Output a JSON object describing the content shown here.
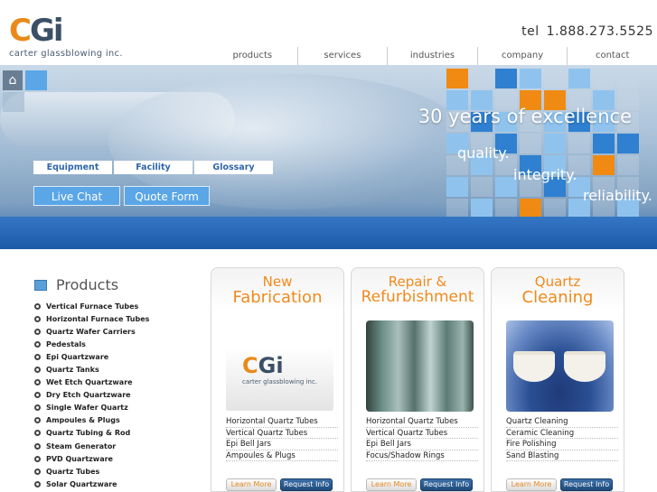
{
  "header": {
    "logo_mark_c": "C",
    "logo_mark_gi": "Gi",
    "logo_text": "carter glassblowing inc.",
    "tel_label": "tel",
    "tel_number": "1.888.273.5525"
  },
  "topnav": [
    "products",
    "services",
    "industries",
    "company",
    "contact"
  ],
  "hero": {
    "headline": "30 years of excellence",
    "quality": "quality.",
    "integrity": "integrity.",
    "reliability": "reliability.",
    "subnav": [
      "Equipment",
      "Facility",
      "Glossary"
    ],
    "live_chat": "Live Chat",
    "quote_form": "Quote Form",
    "colors": {
      "orange": "#f08a12",
      "blue": "#2f80d0",
      "light_blue": "#8fc3ee",
      "band": "#2d6cba"
    }
  },
  "products": {
    "title": "Products",
    "items": [
      "Vertical Furnace Tubes",
      "Horizontal Furnace Tubes",
      "Quartz Wafer Carriers",
      "Pedestals",
      "Epi Quartzware",
      "Quartz Tanks",
      "Wet Etch Quartzware",
      "Dry Etch Quartzware",
      "Single Wafer Quartz",
      "Ampoules & Plugs",
      "Quartz Tubing & Rod",
      "Steam Generator",
      "PVD Quartzware",
      "Quartz Tubes",
      "Solar Quartzware"
    ]
  },
  "cards": [
    {
      "title_small": "New",
      "title_large": "Fabrication",
      "image_logo_c": "C",
      "image_logo_gi": "Gi",
      "image_logo_text": "carter glassblowing inc.",
      "items": [
        "Horizontal Quartz Tubes",
        "Vertical Quartz Tubes",
        "Epi Bell Jars",
        "Ampoules & Plugs"
      ],
      "learn": "Learn More",
      "request": "Request Info"
    },
    {
      "title_small": "Repair &",
      "title_large": "Refurbishment",
      "items": [
        "Horizontal Quartz Tubes",
        "Vertical Quartz Tubes",
        "Epi Bell Jars",
        "Focus/Shadow Rings"
      ],
      "learn": "Learn More",
      "request": "Request Info"
    },
    {
      "title_small": "Quartz",
      "title_large": "Cleaning",
      "items": [
        "Quartz Cleaning",
        "Ceramic Cleaning",
        "Fire Polishing",
        "Sand Blasting"
      ],
      "learn": "Learn More",
      "request": "Request Info"
    }
  ]
}
